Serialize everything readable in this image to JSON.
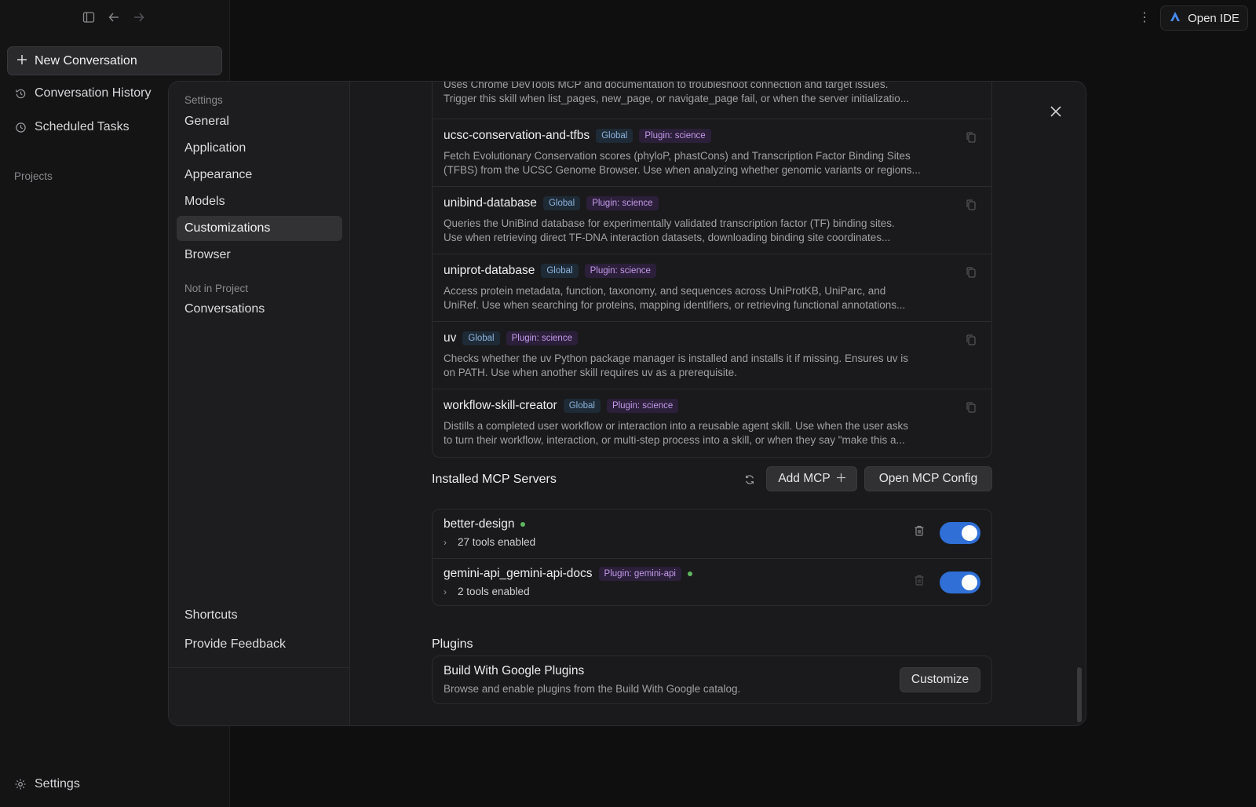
{
  "app_sidebar": {
    "new_conversation": "New Conversation",
    "conversation_history": "Conversation History",
    "scheduled_tasks": "Scheduled Tasks",
    "projects_label": "Projects",
    "settings": "Settings"
  },
  "topbar": {
    "open_ide": "Open IDE"
  },
  "settings_nav": {
    "group_settings": "Settings",
    "items": [
      "General",
      "Application",
      "Appearance",
      "Models",
      "Customizations",
      "Browser"
    ],
    "active": "Customizations",
    "group_not_in_project": "Not in Project",
    "conversations": "Conversations",
    "shortcuts": "Shortcuts",
    "provide_feedback": "Provide Feedback"
  },
  "skills": [
    {
      "name": "",
      "desc1": "Uses Chrome DevTools MCP and documentation to troubleshoot connection and target issues.",
      "desc2": "Trigger this skill when list_pages, new_page, or navigate_page fail, or when the server initializatio..."
    },
    {
      "name": "ucsc-conservation-and-tfbs",
      "scope": "Global",
      "plugin": "Plugin: science",
      "desc1": "Fetch Evolutionary Conservation scores (phyloP, phastCons) and Transcription Factor Binding Sites",
      "desc2": "(TFBS) from the UCSC Genome Browser. Use when analyzing whether genomic variants or regions..."
    },
    {
      "name": "unibind-database",
      "scope": "Global",
      "plugin": "Plugin: science",
      "desc1": "Queries the UniBind database for experimentally validated transcription factor (TF) binding sites.",
      "desc2": "Use when retrieving direct TF-DNA interaction datasets, downloading binding site coordinates..."
    },
    {
      "name": "uniprot-database",
      "scope": "Global",
      "plugin": "Plugin: science",
      "desc1": "Access protein metadata, function, taxonomy, and sequences across UniProtKB, UniParc, and",
      "desc2": "UniRef. Use when searching for proteins, mapping identifiers, or retrieving functional annotations..."
    },
    {
      "name": "uv",
      "scope": "Global",
      "plugin": "Plugin: science",
      "desc1": "Checks whether the uv Python package manager is installed and installs it if missing. Ensures uv is",
      "desc2": "on PATH. Use when another skill requires uv as a prerequisite."
    },
    {
      "name": "workflow-skill-creator",
      "scope": "Global",
      "plugin": "Plugin: science",
      "desc1": "Distills a completed user workflow or interaction into a reusable agent skill. Use when the user asks",
      "desc2": "to turn their workflow, interaction, or multi-step process into a skill, or when they say \"make this a..."
    }
  ],
  "mcp": {
    "title": "Installed MCP Servers",
    "add_mcp": "Add MCP",
    "open_config": "Open MCP Config",
    "servers": [
      {
        "name": "better-design",
        "plugin": "",
        "tools": "27 tools enabled",
        "enabled": true
      },
      {
        "name": "gemini-api_gemini-api-docs",
        "plugin": "Plugin: gemini-api",
        "tools": "2 tools enabled",
        "enabled": true
      }
    ]
  },
  "plugins": {
    "title": "Plugins",
    "card_title": "Build With Google Plugins",
    "card_desc": "Browse and enable plugins from the Build With Google catalog.",
    "customize": "Customize"
  },
  "colors": {
    "accent": "#2f6fd6",
    "status_ok": "#5fb65f",
    "badge_global": "#8cb4dc",
    "badge_plugin": "#c39ae8"
  }
}
